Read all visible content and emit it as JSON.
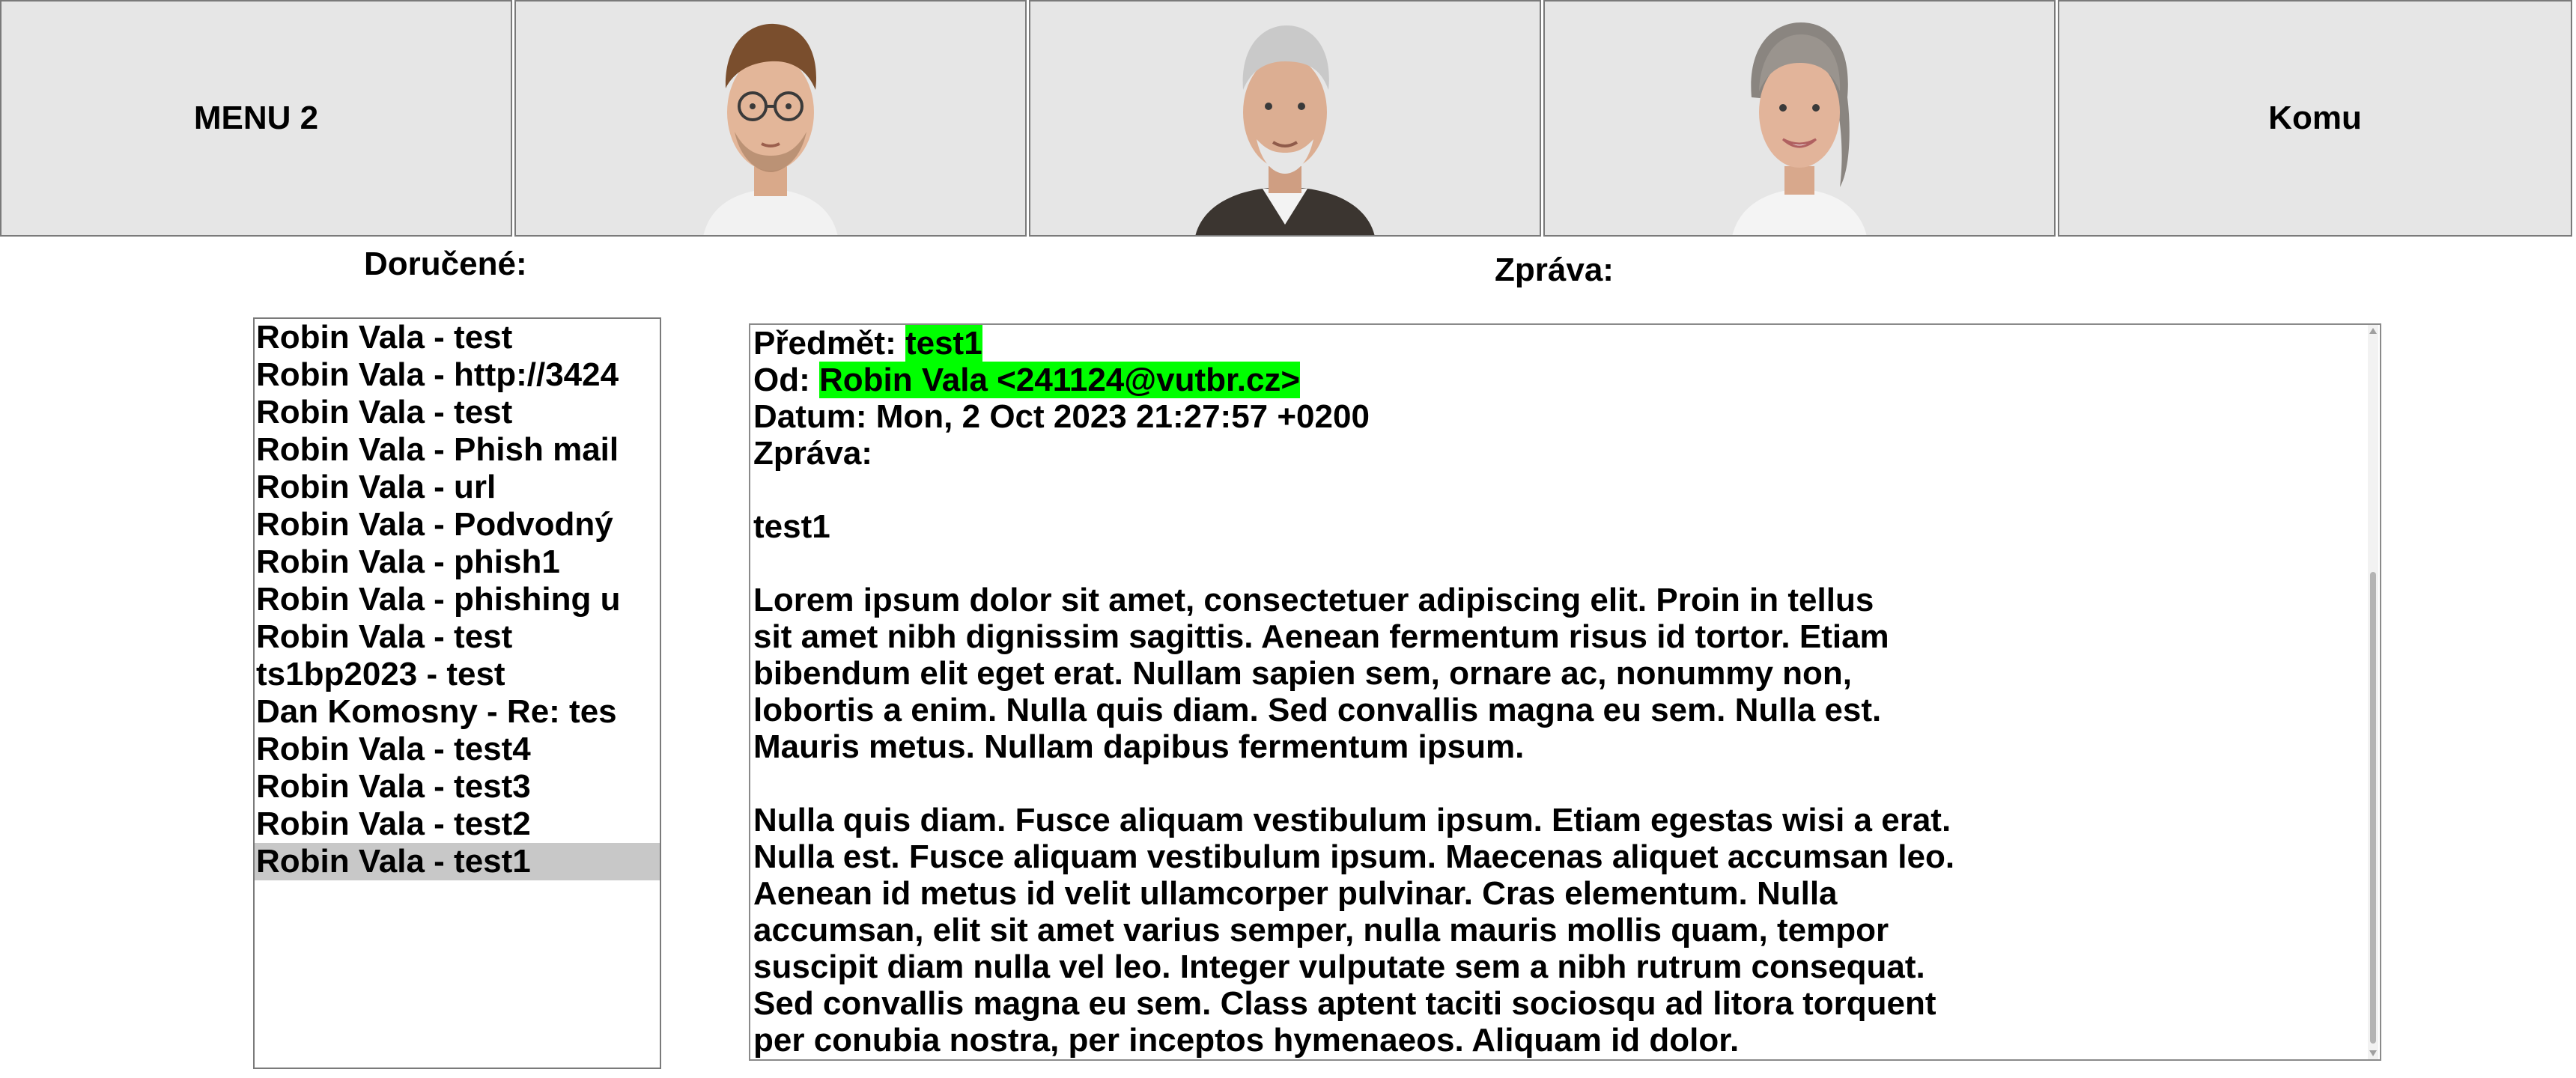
{
  "topbar": {
    "menu_label": "MENU 2",
    "recipient_label": "Komu",
    "avatars": [
      {
        "icon": "young-man-glasses-avatar"
      },
      {
        "icon": "older-man-beard-avatar"
      },
      {
        "icon": "older-woman-smiling-avatar"
      }
    ]
  },
  "inbox": {
    "title": "Doručené:",
    "items": [
      "Robin Vala -  test",
      "Robin Vala -  http://3424",
      "Robin Vala -  test",
      "Robin Vala -  Phish mail",
      "Robin Vala -  url",
      "Robin Vala -  Podvodný",
      "Robin Vala -  phish1",
      "Robin Vala -  phishing u",
      "Robin Vala -  test",
      "ts1bp2023 -  test",
      "Dan Komosny -  Re: tes",
      "Robin Vala -  test4",
      "Robin Vala -  test3",
      "Robin Vala -  test2",
      "Robin Vala -  test1"
    ],
    "selected_index": 14
  },
  "message": {
    "title": "Zpráva:",
    "subject_label": "Předmět:",
    "subject_value": "test1",
    "from_label": "Od:",
    "from_value": "Robin Vala <241124@vutbr.cz>",
    "date_line": "Datum: Mon, 2 Oct 2023 21:27:57 +0200",
    "body_label": "Zpráva:",
    "body_first": "test1",
    "paragraph1": "Lorem ipsum dolor sit amet, consectetuer adipiscing elit. Proin in tellus\nsit amet nibh dignissim sagittis. Aenean fermentum risus id tortor. Etiam\nbibendum elit eget erat. Nullam sapien sem, ornare ac, nonummy non,\nlobortis a enim. Nulla quis diam. Sed convallis magna eu sem. Nulla est.\nMauris metus. Nullam dapibus fermentum ipsum.",
    "paragraph2": "Nulla quis diam. Fusce aliquam vestibulum ipsum. Etiam egestas wisi a erat.\nNulla est. Fusce aliquam vestibulum ipsum. Maecenas aliquet accumsan leo.\nAenean id metus id velit ullamcorper pulvinar. Cras elementum. Nulla\naccumsan, elit sit amet varius semper, nulla mauris mollis quam, tempor\nsuscipit diam nulla vel leo. Integer vulputate sem a nibh rutrum consequat.\nSed convallis magna eu sem. Class aptent taciti sociosqu ad litora torquent\nper conubia nostra, per inceptos hymenaeos. Aliquam id dolor."
  },
  "colors": {
    "highlight": "#00ff00",
    "tile_bg": "#e6e6e6",
    "selected_row": "#c8c8c8"
  }
}
